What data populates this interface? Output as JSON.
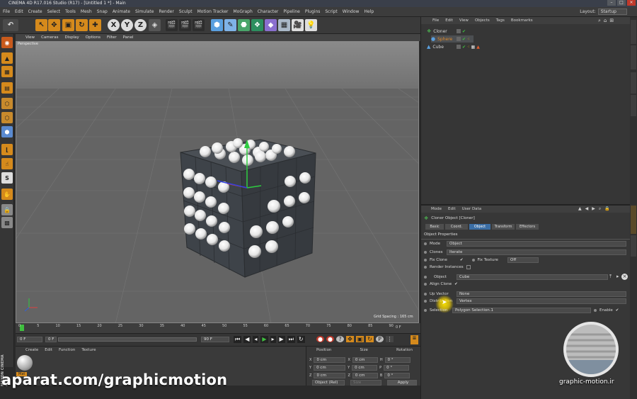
{
  "app": {
    "title": "CINEMA 4D R17.016 Studio (R17) - [Untitled 1 *] - Main"
  },
  "menubar": {
    "items": [
      "File",
      "Edit",
      "Create",
      "Select",
      "Tools",
      "Mesh",
      "Snap",
      "Animate",
      "Simulate",
      "Render",
      "Sculpt",
      "Motion Tracker",
      "MoGraph",
      "Character",
      "Pipeline",
      "Plugins",
      "Script",
      "Window",
      "Help"
    ],
    "layout_label": "Layout:",
    "layout_value": "Startup"
  },
  "toolbar": {
    "axis_x": "X",
    "axis_y": "Y",
    "axis_z": "Z"
  },
  "viewport": {
    "menu": [
      "View",
      "Cameras",
      "Display",
      "Options",
      "Filter",
      "Panel"
    ],
    "label": "Perspective",
    "grid_spacing": "Grid Spacing : 165 cm"
  },
  "timeline": {
    "ticks": [
      "0",
      "5",
      "10",
      "15",
      "20",
      "25",
      "30",
      "35",
      "40",
      "45",
      "50",
      "55",
      "60",
      "65",
      "70",
      "75",
      "80",
      "85",
      "90"
    ],
    "end_frame": "0 F"
  },
  "playbar": {
    "current_frame": "0 F",
    "start_field": "0 F",
    "end_field": "90 F",
    "end_field2": "90 F"
  },
  "material_manager": {
    "menu": [
      "Create",
      "Edit",
      "Function",
      "Texture"
    ],
    "material_name": "Mat"
  },
  "coordinates": {
    "headers": [
      "Position",
      "Size",
      "Rotation"
    ],
    "rows": [
      {
        "axis": "X",
        "pos": "0 cm",
        "size": "0 cm",
        "rot_label": "H",
        "rot": "0 °"
      },
      {
        "axis": "Y",
        "pos": "0 cm",
        "size": "0 cm",
        "rot_label": "P",
        "rot": "0 °"
      },
      {
        "axis": "Z",
        "pos": "0 cm",
        "size": "0 cm",
        "rot_label": "B",
        "rot": "0 °"
      }
    ],
    "mode": "Object (Rel)",
    "size_mode": "Size",
    "apply": "Apply"
  },
  "object_manager": {
    "menu": [
      "File",
      "Edit",
      "View",
      "Objects",
      "Tags",
      "Bookmarks"
    ],
    "objects": [
      {
        "name": "Cloner",
        "indent": 0
      },
      {
        "name": "Sphere",
        "indent": 1
      },
      {
        "name": "Cube",
        "indent": 0
      }
    ]
  },
  "attribute_manager": {
    "menu": [
      "Mode",
      "Edit",
      "User Data"
    ],
    "object_title": "Cloner Object [Cloner]",
    "tabs": [
      "Basic",
      "Coord.",
      "Object",
      "Transform",
      "Effectors"
    ],
    "active_tab": "Object",
    "section": "Object Properties",
    "mode_label": "Mode",
    "mode_value": "Object",
    "clones_label": "Clones",
    "clones_value": "Iterate",
    "fix_clone_label": "Fix Clone",
    "fix_texture_label": "Fix Texture",
    "fix_texture_value": "Off",
    "render_instances_label": "Render Instances",
    "object_label": "Object",
    "object_value": "Cube",
    "align_clone_label": "Align Clone",
    "up_vector_label": "Up Vector",
    "up_vector_value": "None",
    "distribution_label": "Distribution",
    "distribution_value": "Vertex",
    "selection_label": "Selection",
    "selection_value": "Polygon Selection.1",
    "enable_label": "Enable"
  },
  "watermark": {
    "left": "aparat.com/graphicmotion",
    "right": "graphic-motion.ir"
  },
  "side_brand": "MAXON CINEMA 4D",
  "colors": {
    "accent": "#3b6ea5",
    "viewport_bg": "#6b6b6b"
  }
}
